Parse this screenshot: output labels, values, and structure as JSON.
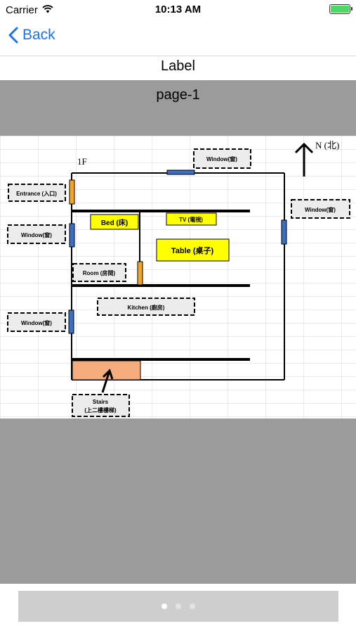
{
  "status_bar": {
    "carrier": "Carrier",
    "time": "10:13 AM",
    "wifi_icon": "wifi-icon",
    "battery_icon": "battery-icon",
    "battery_color": "#4cd964"
  },
  "nav": {
    "back_label": "Back",
    "back_icon": "chevron-left-icon",
    "accent": "#1a73e8"
  },
  "label": "Label",
  "page_title": "page-1",
  "floor_plan": {
    "floor_label": "1F",
    "compass": "N (北)",
    "labels": {
      "entrance": "Entrance (入口)",
      "window_top": "Window(窗)",
      "window_right": "Window(窗)",
      "window_left_top": "Window(窗)",
      "window_left_bottom": "Window(窗)",
      "bed": "Bed (床)",
      "tv": "TV (電視)",
      "table": "Table (桌子)",
      "room": "Room (房間)",
      "kitchen": "Kitchen (廚房)",
      "stairs_line1": "Stairs",
      "stairs_line2": "(上二樓樓梯)"
    },
    "colors": {
      "window": "#3a6fc4",
      "door": "#f2a623",
      "furniture": "#ffff00",
      "stairs": "#f5ad7d"
    }
  },
  "pager": {
    "page_count": 3,
    "current_page": 1
  }
}
